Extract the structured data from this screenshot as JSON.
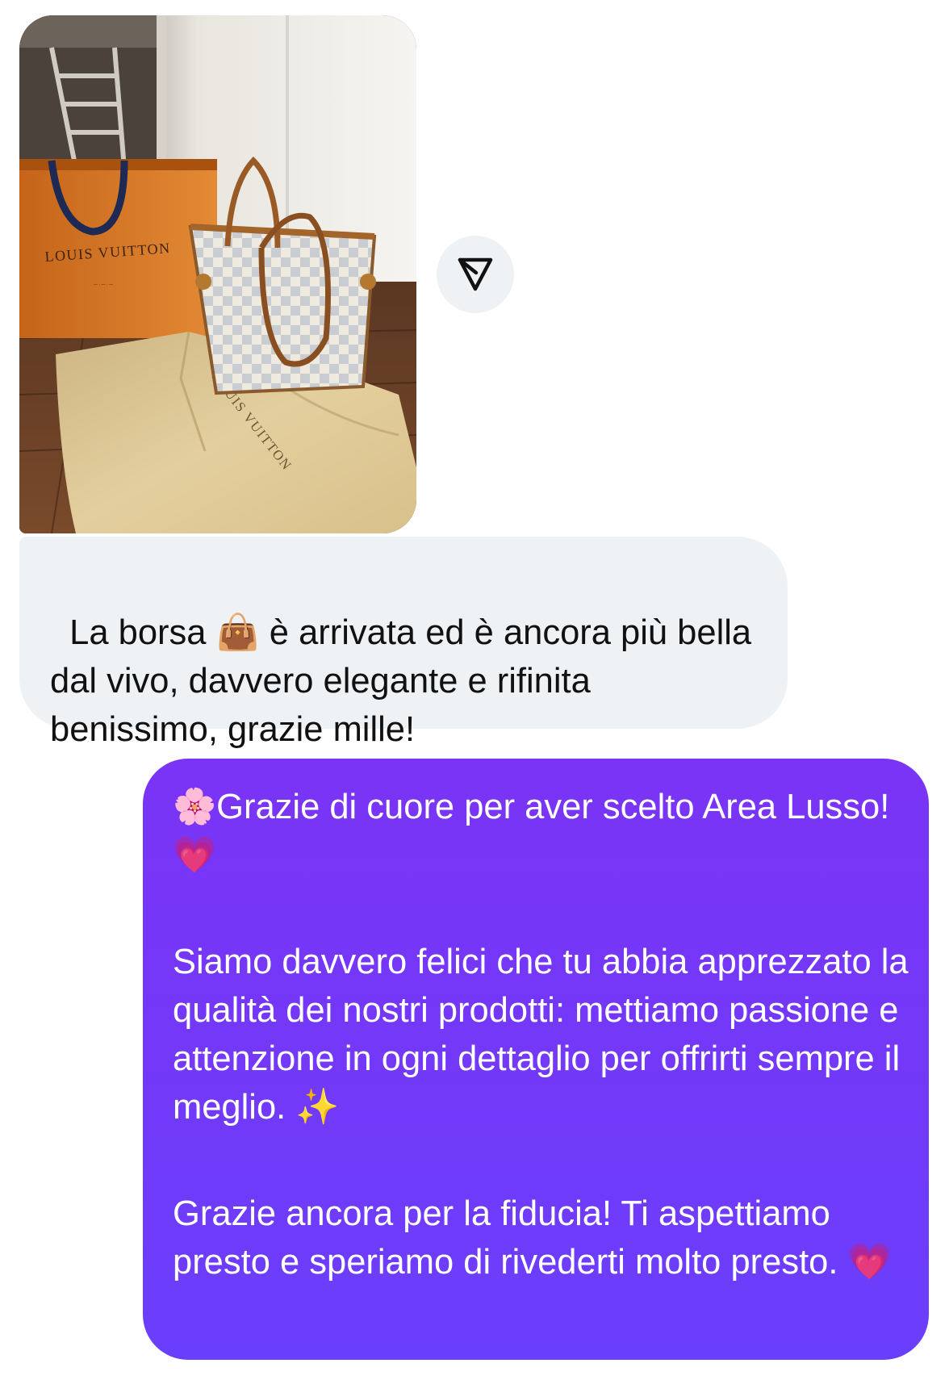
{
  "conversation": {
    "incoming_photo": {
      "alt": "Borsa Louis Vuitton con scatola arancione e dust bag",
      "shopping_bag_brand": "LOUIS VUITTON",
      "dust_bag_brand": "LOUIS VUITTON"
    },
    "share_button": {
      "icon": "send-icon"
    },
    "incoming_message": {
      "text": "La borsa 👜 è arrivata ed è ancora più bella dal vivo, davvero elegante e rifinita benissimo, grazie mille!"
    },
    "outgoing_message": {
      "paragraphs": [
        "🌸Grazie di cuore per aver scelto Area Lusso!💗",
        "Siamo davvero felici che tu abbia apprezzato la qualità dei nostri prodotti: mettiamo passione e attenzione in ogni dettaglio per offrirti sempre il meglio. ✨",
        "Grazie ancora per la fiducia! Ti aspettiamo presto e speriamo di rivederti molto presto. 💗"
      ]
    }
  },
  "theme": {
    "incoming_bubble_color": "#eff2f5",
    "outgoing_bubble_color": "#7338f8",
    "text_dark": "#111111",
    "text_light": "#ffffff"
  }
}
